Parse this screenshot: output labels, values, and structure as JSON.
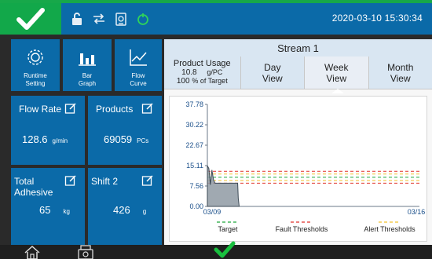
{
  "topbar": {
    "datetime": "2020-03-10 15:30:34",
    "icons": [
      "check-icon",
      "lock-icon",
      "transfer-icon",
      "clipboard-icon",
      "power-ring-icon"
    ]
  },
  "tiles": [
    {
      "label_line1": "Runtime",
      "label_line2": "Setting",
      "icon": "gear-icon"
    },
    {
      "label_line1": "Bar",
      "label_line2": "Graph",
      "icon": "bar-chart-icon"
    },
    {
      "label_line1": "Flow",
      "label_line2": "Curve",
      "icon": "line-chart-icon"
    }
  ],
  "stats": {
    "flow_rate": {
      "title": "Flow Rate",
      "value": "128.6",
      "unit": "g/min"
    },
    "products": {
      "title": "Products",
      "value": "69059",
      "unit": "PCs"
    },
    "total_adhesive": {
      "title_line1": "Total",
      "title_line2": "Adhesive",
      "value": "65",
      "unit": "kg"
    },
    "shift": {
      "title": "Shift 2",
      "value": "426",
      "unit": "g"
    }
  },
  "panel": {
    "title": "Stream 1",
    "product_usage": {
      "title": "Product Usage",
      "value": "10.8",
      "unit": "g/PC",
      "percent": "100",
      "percent_label": "% of Target"
    },
    "tabs": [
      {
        "line1": "Day",
        "line2": "View"
      },
      {
        "line1": "Week",
        "line2": "View"
      },
      {
        "line1": "Month",
        "line2": "View"
      }
    ],
    "active_tab": "Week"
  },
  "colors": {
    "tile_blue": "#0b6aa8",
    "green": "#17a84a",
    "target": "#1fa83a",
    "fault": "#e0312a",
    "alert": "#f2c22e",
    "series_fill": "#8f9aa3"
  },
  "chart_data": {
    "type": "area",
    "x_tick_labels": [
      "03/09",
      "03/16"
    ],
    "y_ticks": [
      0.0,
      7.56,
      15.11,
      22.67,
      30.22,
      37.78
    ],
    "y_tick_labels": [
      "0.00",
      "7.56",
      "15.11",
      "22.67",
      "30.22",
      "37.78"
    ],
    "ylim": [
      0,
      37.78
    ],
    "xlim": [
      0,
      7
    ],
    "series": [
      {
        "values_x": [
          0,
          0.05,
          0.1,
          0.15,
          0.2,
          0.25,
          0.3,
          0.5,
          0.7,
          0.9,
          1.0,
          1.02,
          1.05
        ],
        "values_y": [
          15.1,
          14.0,
          8.0,
          13.5,
          10.0,
          8.6,
          8.6,
          8.6,
          8.6,
          8.6,
          8.6,
          3.0,
          0.0
        ]
      }
    ],
    "thresholds": [
      {
        "name": "Target",
        "color": "#1fa83a",
        "y": 10.8
      },
      {
        "name": "Fault Thresholds",
        "color": "#e0312a",
        "y": 13.0
      },
      {
        "name": "Fault Thresholds",
        "color": "#e0312a",
        "y": 8.6
      },
      {
        "name": "Alert Thresholds",
        "color": "#f2c22e",
        "y": 12.0
      },
      {
        "name": "Alert Thresholds",
        "color": "#f2c22e",
        "y": 9.6
      }
    ],
    "legend": [
      "Target",
      "Fault Thresholds",
      "Alert Thresholds"
    ],
    "legend_position": "bottom",
    "grid": false
  }
}
